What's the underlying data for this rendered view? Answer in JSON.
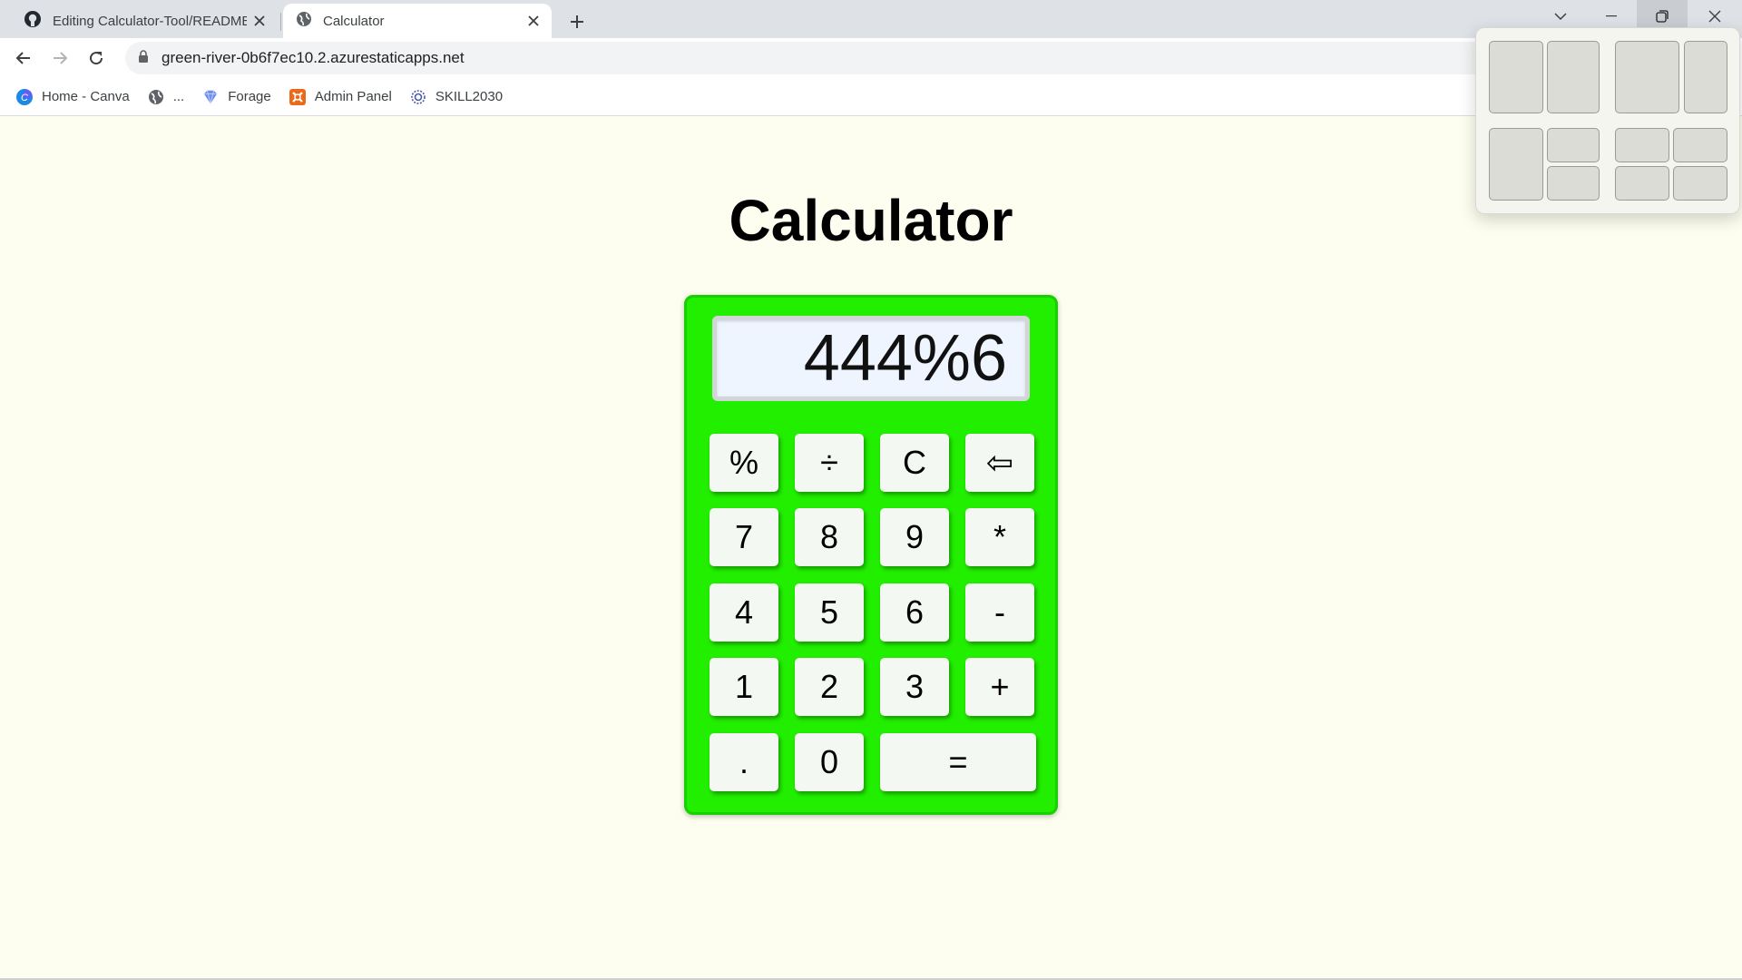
{
  "browser": {
    "tabs": [
      {
        "title": "Editing Calculator-Tool/README.md",
        "active": false,
        "icon": "github-icon"
      },
      {
        "title": "Calculator",
        "active": true,
        "icon": "globe-icon"
      }
    ],
    "url": "green-river-0b6f7ec10.2.azurestaticapps.net",
    "bookmarks": [
      {
        "label": "Home - Canva",
        "icon": "canva-icon"
      },
      {
        "label": "...",
        "icon": "globe-icon"
      },
      {
        "label": "Forage",
        "icon": "forage-icon"
      },
      {
        "label": "Admin Panel",
        "icon": "admin-panel-icon"
      },
      {
        "label": "SKILL2030",
        "icon": "skill2030-icon"
      }
    ]
  },
  "page": {
    "title": "Calculator"
  },
  "calculator": {
    "display": "444%6",
    "keys": {
      "percent": "%",
      "divide": "÷",
      "clear": "C",
      "backspace": "⇦",
      "seven": "7",
      "eight": "8",
      "nine": "9",
      "multiply": "*",
      "four": "4",
      "five": "5",
      "six": "6",
      "minus": "-",
      "one": "1",
      "two": "2",
      "three": "3",
      "plus": "+",
      "decimal": ".",
      "zero": "0",
      "equals": "="
    },
    "colors": {
      "body": "#22ee00",
      "display_bg": "#eef5ff",
      "page_bg": "#fdfeef"
    }
  }
}
